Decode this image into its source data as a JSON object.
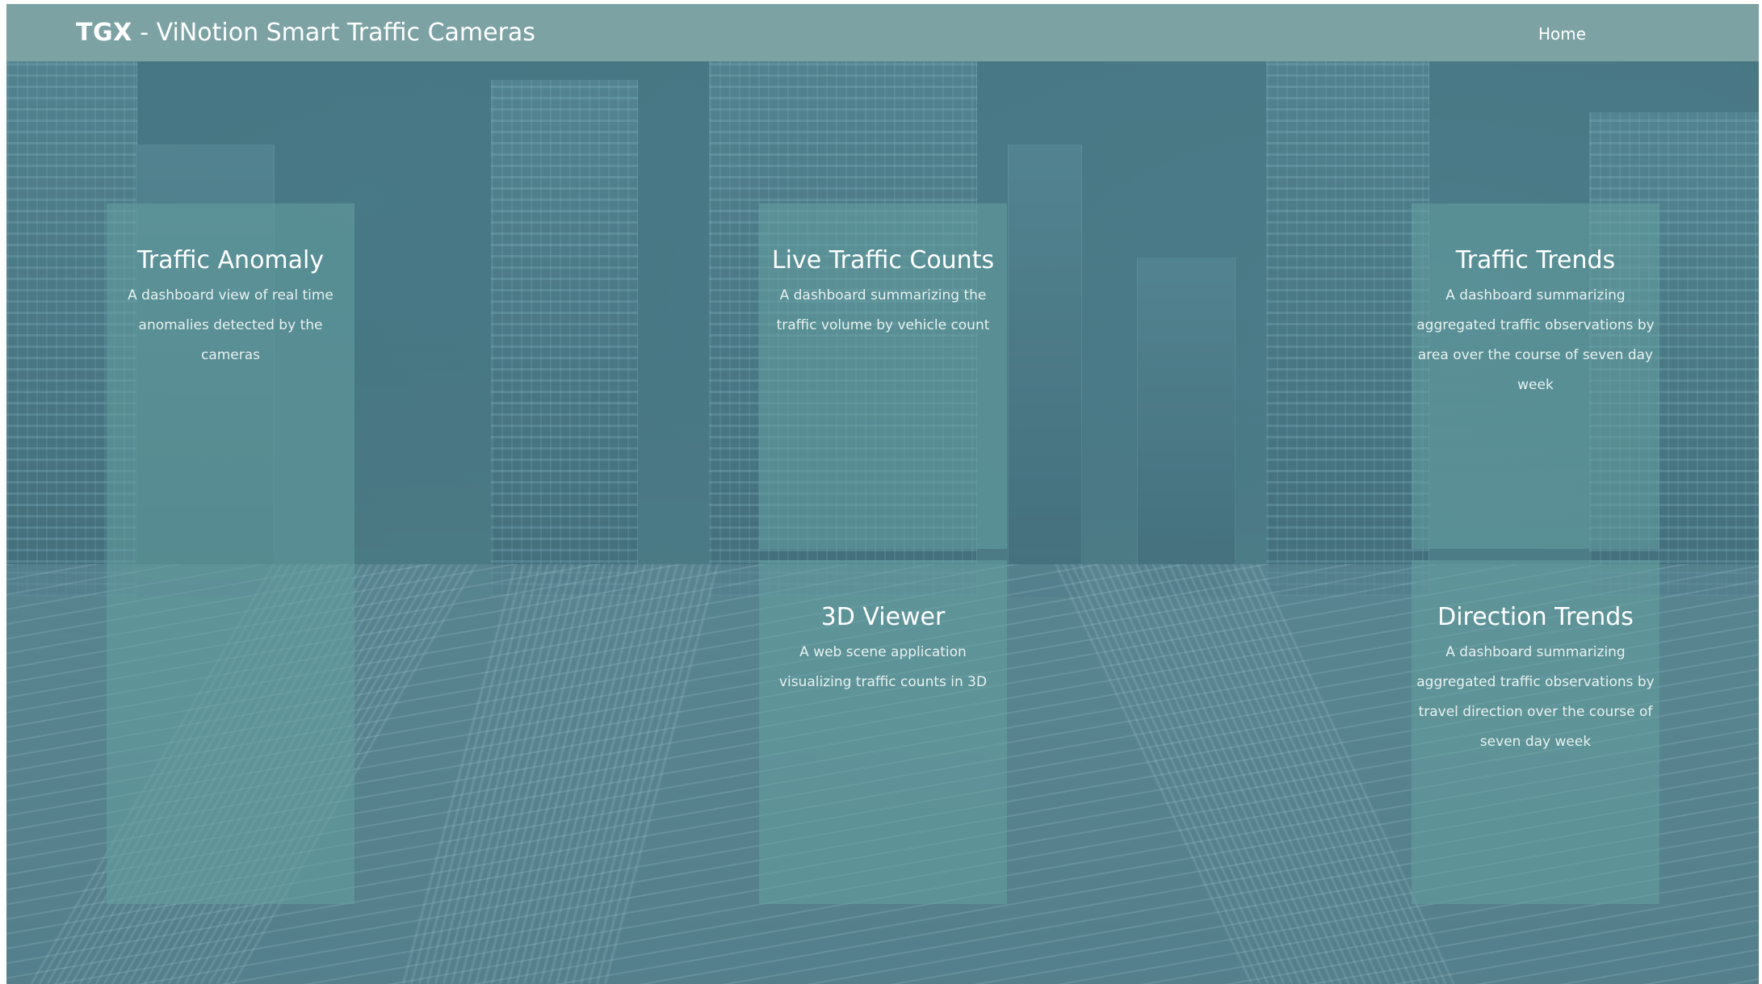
{
  "navbar": {
    "brand_strong": "TGX",
    "brand_rest": " - ViNotion Smart Traffic Cameras",
    "home_link": "Home"
  },
  "cards": [
    {
      "title": "Traffic Anomaly",
      "description": "A dashboard view of real time anomalies detected by the cameras"
    },
    {
      "title": "Live Traffic Counts",
      "description": "A dashboard summarizing the traffic volume by vehicle count"
    },
    {
      "title": "Traffic Trends",
      "description": "A dashboard summarizing aggregated traffic observations by area over the course of seven day week"
    },
    {
      "title": "3D Viewer",
      "description": "A web scene application visualizing traffic counts in 3D"
    },
    {
      "title": "Direction Trends",
      "description": "A dashboard summarizing aggregated traffic observations by travel direction over the course of seven day week"
    }
  ]
}
